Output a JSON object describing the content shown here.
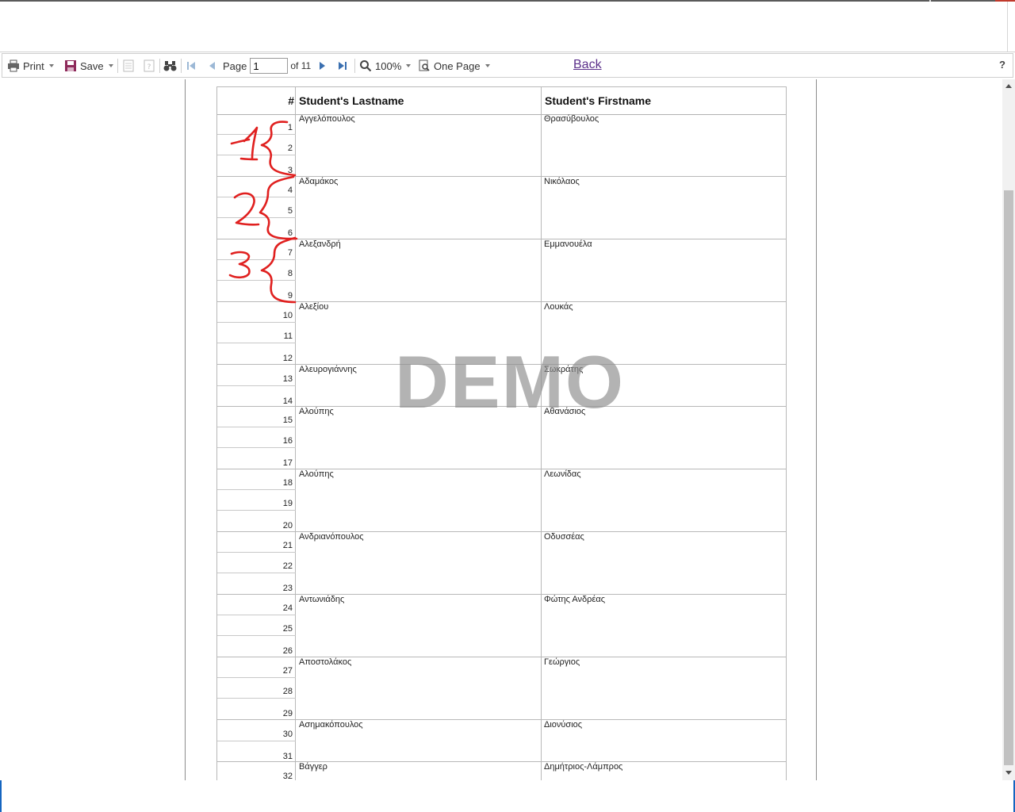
{
  "toolbar": {
    "print_label": "Print",
    "save_label": "Save",
    "page_label": "Page",
    "page_value": "1",
    "page_of": "of 11",
    "zoom_label": "100%",
    "view_label": "One Page",
    "back_label": "Back",
    "help_label": "?"
  },
  "table": {
    "headers": {
      "num": "#",
      "lastname": "Student's Lastname",
      "firstname": "Student's Firstname"
    },
    "groups": [
      {
        "lastname": "Αγγελόπουλος",
        "firstname": "Θρασύβουλος",
        "rows": [
          "1",
          "2",
          "3"
        ]
      },
      {
        "lastname": "Αδαμάκος",
        "firstname": "Νικόλαος",
        "rows": [
          "4",
          "5",
          "6"
        ]
      },
      {
        "lastname": "Αλεξανδρή",
        "firstname": "Εμμανουέλα",
        "rows": [
          "7",
          "8",
          "9"
        ]
      },
      {
        "lastname": "Αλεξίου",
        "firstname": "Λουκάς",
        "rows": [
          "10",
          "11",
          "12"
        ]
      },
      {
        "lastname": "Αλευρογιάννης",
        "firstname": "Σωκράτης",
        "rows": [
          "13",
          "14"
        ]
      },
      {
        "lastname": "Αλούπης",
        "firstname": "Αθανάσιος",
        "rows": [
          "15",
          "16",
          "17"
        ]
      },
      {
        "lastname": "Αλούπης",
        "firstname": "Λεωνίδας",
        "rows": [
          "18",
          "19",
          "20"
        ]
      },
      {
        "lastname": "Ανδριανόπουλος",
        "firstname": "Οδυσσέας",
        "rows": [
          "21",
          "22",
          "23"
        ]
      },
      {
        "lastname": "Αντωνιάδης",
        "firstname": "Φώτης Ανδρέας",
        "rows": [
          "24",
          "25",
          "26"
        ]
      },
      {
        "lastname": "Αποστολάκος",
        "firstname": "Γεώργιος",
        "rows": [
          "27",
          "28",
          "29"
        ]
      },
      {
        "lastname": "Ασημακόπουλος",
        "firstname": "Διονύσιος",
        "rows": [
          "30",
          "31"
        ]
      },
      {
        "lastname": "Βάγγερ",
        "firstname": "Δημήτριος-Λάμπρος",
        "rows": [
          "32"
        ]
      }
    ]
  },
  "watermark": "DEMO",
  "annotations": [
    "1",
    "2",
    "3"
  ],
  "colors": {
    "annotation": "#e0201f",
    "link": "#5b2f8a",
    "watermark": "#8c8c8c",
    "save_icon": "#8e2a5a",
    "nav_icon": "#3a6fb0"
  }
}
